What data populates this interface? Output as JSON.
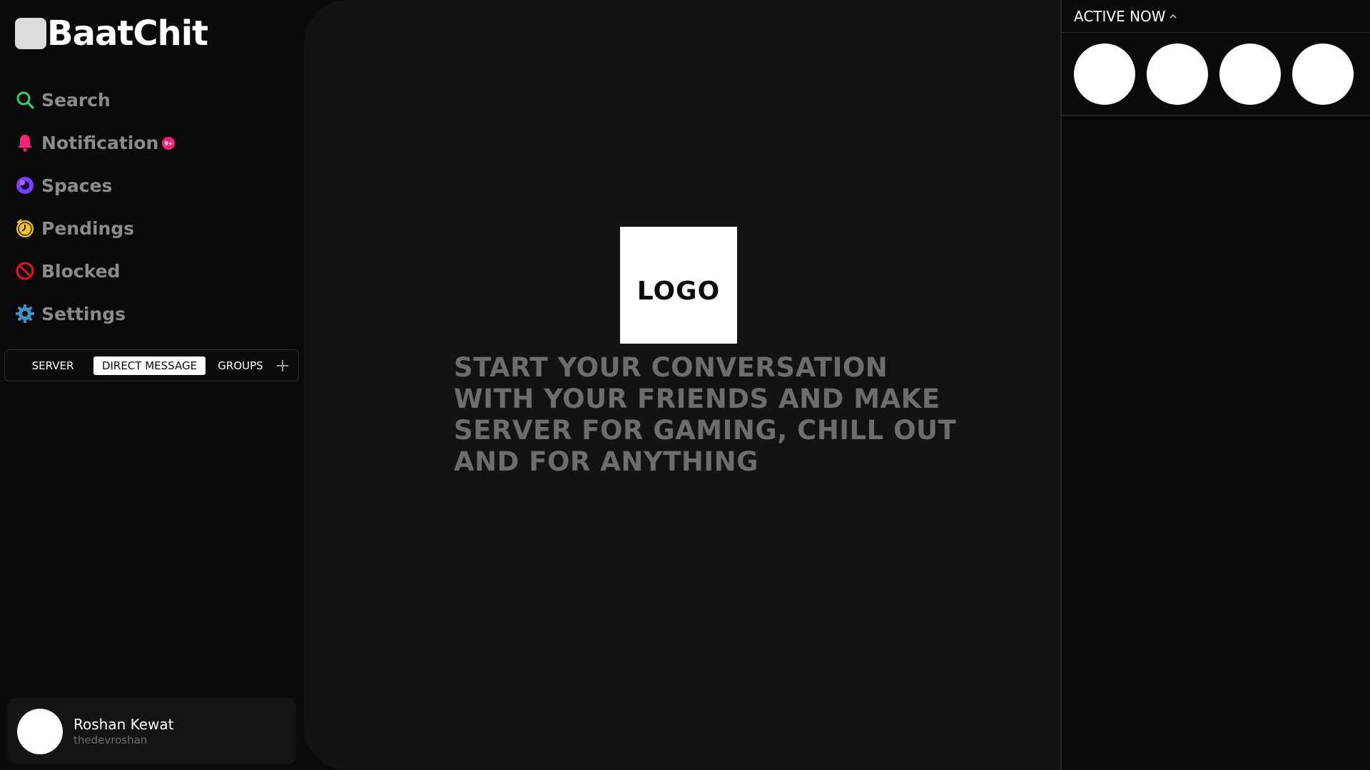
{
  "brand": {
    "name": "BaatChit"
  },
  "nav": {
    "items": [
      {
        "label": "Search",
        "icon": "search-icon",
        "color": "#2fd17c"
      },
      {
        "label": "Notification",
        "icon": "bell-icon",
        "color": "#ff1f7a",
        "badge": "9+"
      },
      {
        "label": "Spaces",
        "icon": "spaces-icon",
        "color": "#7a3cff"
      },
      {
        "label": "Pendings",
        "icon": "clock-icon",
        "color": "#f5c518"
      },
      {
        "label": "Blocked",
        "icon": "block-icon",
        "color": "#e0142b"
      },
      {
        "label": "Settings",
        "icon": "gear-icon",
        "color": "#3f93c9"
      }
    ]
  },
  "tabs": {
    "items": [
      "SERVER",
      "DIRECT MESSAGE",
      "GROUPS"
    ],
    "active": "DIRECT MESSAGE",
    "add_icon": "plus-icon"
  },
  "user": {
    "name": "Roshan Kewat",
    "handle": "thedevroshan"
  },
  "main": {
    "logo_text": "LOGO",
    "tagline": "START YOUR CONVERSATION WITH YOUR FRIENDS AND MAKE SERVER FOR GAMING, CHILL OUT AND FOR ANYTHING"
  },
  "active_now": {
    "title": "ACTIVE NOW",
    "caret_icon": "chevron-up-icon",
    "count": 4
  },
  "colors": {
    "background": "#0a0a0a",
    "panel": "#131313",
    "muted_text": "#8b8b8b",
    "tagline_text": "#6d6d6d",
    "accent_badge": "#ff1f7a"
  }
}
